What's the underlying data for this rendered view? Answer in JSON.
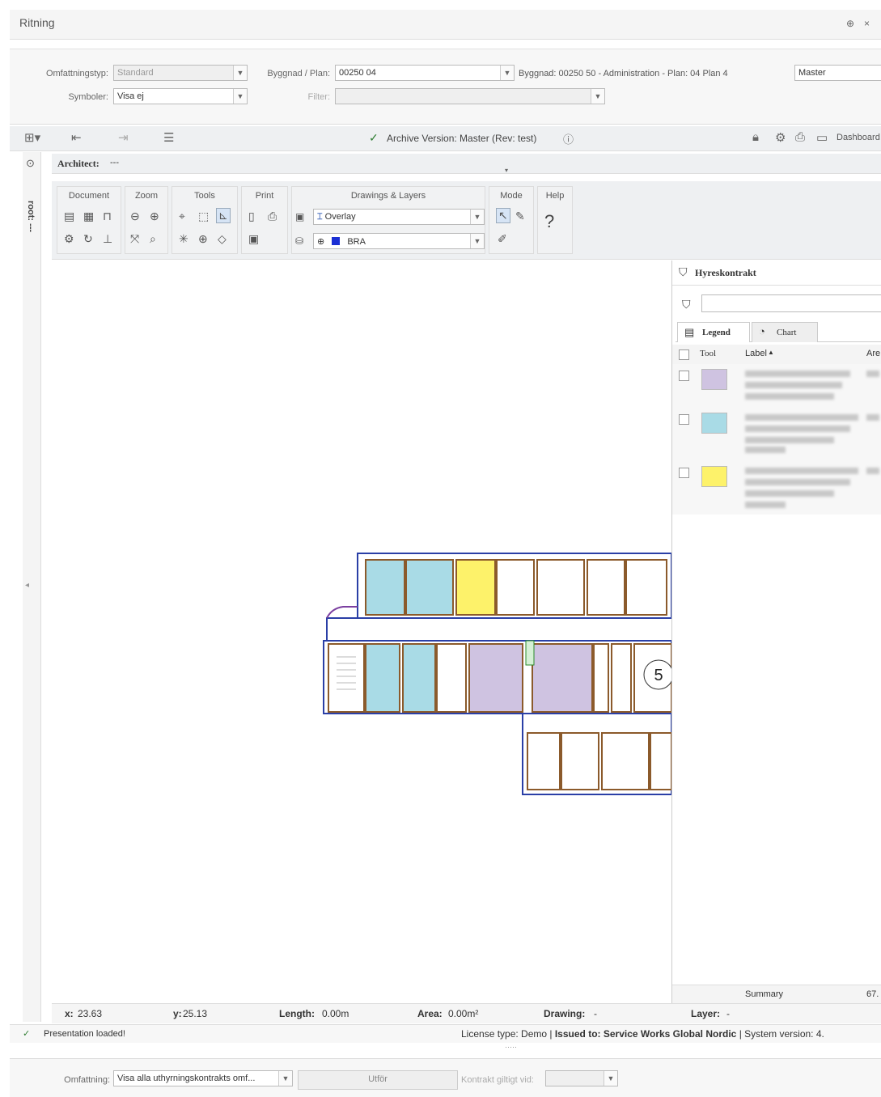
{
  "window": {
    "title": "Ritning",
    "pin": "⊕",
    "close": "×"
  },
  "form": {
    "omfattningstyp_label": "Omfattningstyp:",
    "omfattningstyp_value": "Standard",
    "symboler_label": "Symboler:",
    "symboler_value": "Visa ej",
    "byggnad_label": "Byggnad / Plan:",
    "byggnad_value": "00250  04",
    "byggnad_desc": "Byggnad: 00250  50 - Administration - Plan: 04  Plan 4",
    "filter_label": "Filter:",
    "filter_value": "",
    "version_value": "Master"
  },
  "toolbar": {
    "archive_version": "Archive Version: Master (Rev: test)",
    "dashboard": "Dashboard"
  },
  "sidebar": {
    "label": "root: ---"
  },
  "architect": {
    "label": "Architect:",
    "value": "---"
  },
  "ribbon": {
    "groups": {
      "document": "Document",
      "zoom": "Zoom",
      "tools": "Tools",
      "print": "Print",
      "drawings": "Drawings & Layers",
      "mode": "Mode",
      "help": "Help"
    },
    "overlay_value": "Overlay",
    "layer_value": "BRA"
  },
  "panel": {
    "title": "Hyreskontrakt",
    "filter_placeholder": "",
    "tabs": [
      "Legend",
      "Chart"
    ],
    "columns": {
      "tool": "Tool",
      "label": "Label",
      "area": "Are"
    },
    "rows": [
      {
        "color": "#cfc3e1"
      },
      {
        "color": "#a9dbe6"
      },
      {
        "color": "#fdf26a"
      }
    ],
    "summary_label": "Summary",
    "summary_value": "67."
  },
  "status": {
    "x_label": "x:",
    "x_value": "23.63",
    "y_label": "y:",
    "y_value": "25.13",
    "length_label": "Length:",
    "length_value": "0.00m",
    "area_label": "Area:",
    "area_value": "0.00m²",
    "drawing_label": "Drawing:",
    "drawing_value": "-",
    "layer_label": "Layer:",
    "layer_value": "-"
  },
  "info": {
    "loaded": "Presentation loaded!",
    "license_text": "License type: Demo | ",
    "issued": "Issued to: Service Works Global Nordic",
    "system_text": " | System version: 4.",
    "dots": "·····"
  },
  "footer": {
    "omfattning_label": "Omfattning:",
    "omfattning_value": "Visa alla uthyrningskontrakts omf...",
    "utfor_button": "Utför",
    "kontrakt_label": "Kontrakt giltigt vid:",
    "kontrakt_value": ""
  },
  "floorplan": {
    "room_number": "5"
  },
  "colors": {
    "accent": "#2e7d32",
    "purple": "#cfc3e1",
    "blue": "#a9dbe6",
    "yellow": "#fdf26a",
    "wall": "#2a3fa6"
  }
}
